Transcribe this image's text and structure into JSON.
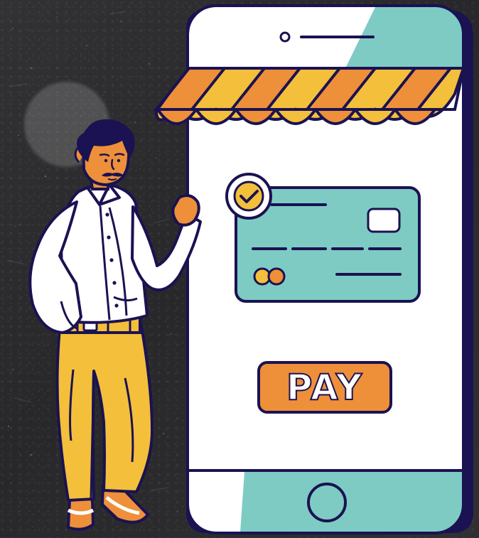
{
  "screen": {
    "pay_button_label": "PAY"
  },
  "icons": {
    "camera": "camera-dot-icon",
    "speaker": "speaker-slot-icon",
    "card": "credit-card-icon",
    "check": "check-circle-icon",
    "home": "home-button-icon",
    "awning": "shop-awning-icon",
    "person": "person-illustration"
  },
  "colors": {
    "background": "#2b2b2d",
    "phone_outline": "#1a1252",
    "phone_screen": "#ffffff",
    "teal": "#7ecbc4",
    "orange": "#ee8f3a",
    "yellow": "#f4bf3a",
    "pants": "#f3b63a",
    "shirt": "#ffffff",
    "skin": "#ee8f3a"
  }
}
